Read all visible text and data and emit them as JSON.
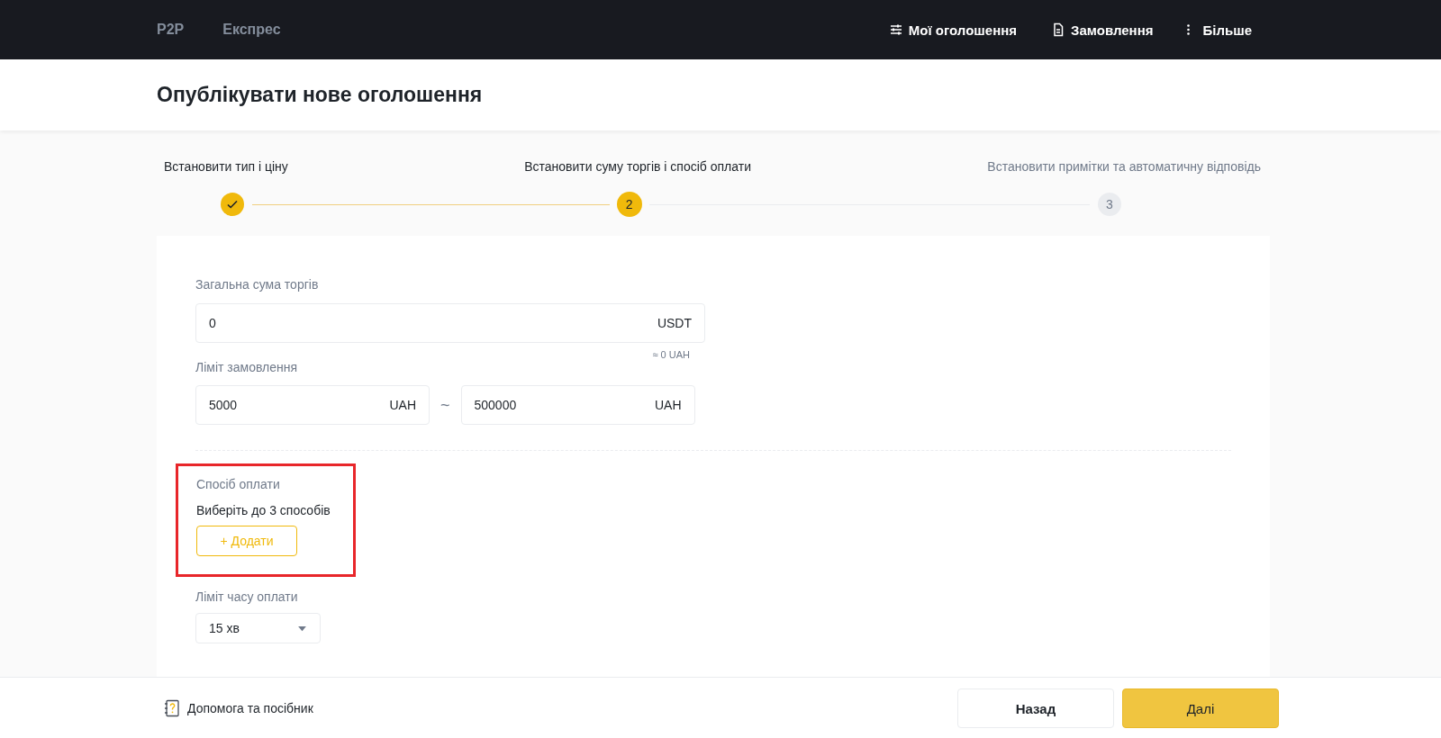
{
  "top_nav": {
    "tabs": [
      {
        "label": "P2P",
        "selected": false
      },
      {
        "label": "Експрес",
        "selected": false
      }
    ],
    "links": [
      {
        "kind": "filters",
        "label": "Мої оголошення"
      },
      {
        "kind": "document",
        "label": "Замовлення"
      },
      {
        "kind": "more",
        "label": "Більше"
      }
    ]
  },
  "page_title": "Опублікувати нове оголошення",
  "steps": [
    {
      "label": "Встановити тип і ціну",
      "completed": true,
      "selected": false
    },
    {
      "label": "Встановити суму торгів і спосіб оплати",
      "completed": false,
      "selected": true,
      "number": "2"
    },
    {
      "label": "Встановити примітки та автоматичну відповідь",
      "completed": false,
      "selected": false,
      "number": "3"
    }
  ],
  "total_amount": {
    "label": "Загальна сума торгів",
    "value": "0",
    "unit": "USDT",
    "approx": "≈ 0 UAH"
  },
  "order_limit": {
    "label": "Ліміт замовлення",
    "min": {
      "value": "5000",
      "unit": "UAH"
    },
    "separator": "~",
    "max": {
      "value": "500000",
      "unit": "UAH"
    }
  },
  "payment_method": {
    "label": "Спосіб оплати",
    "hint": "Виберіть до 3 способів",
    "add_button": "+ Додати",
    "highlighted": true
  },
  "payment_time_limit": {
    "label": "Ліміт часу оплати",
    "value": "15 хв"
  },
  "footer": {
    "help_link": "Допомога та посібник",
    "back_button": "Назад",
    "next_button": "Далі"
  }
}
